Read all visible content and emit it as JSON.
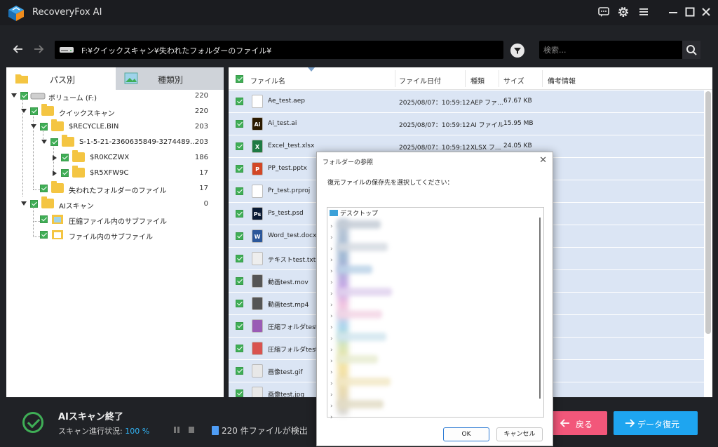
{
  "app": {
    "title": "RecoveryFox AI"
  },
  "pathbar": {
    "path": "F:¥クイックスキャン¥失われたフォルダーのファイル¥"
  },
  "search": {
    "placeholder": "検索..."
  },
  "tabs": [
    {
      "label": "パス別"
    },
    {
      "label": "種類別"
    }
  ],
  "tree": [
    {
      "label": "ボリューム (F:)",
      "count": "220"
    },
    {
      "label": "クイックスキャン",
      "count": "220"
    },
    {
      "label": "$RECYCLE.BIN",
      "count": "203"
    },
    {
      "label": "S-1-5-21-2360635849-3274489...",
      "count": "203"
    },
    {
      "label": "$R0KCZWX",
      "count": "186"
    },
    {
      "label": "$R5XFW9C",
      "count": "17"
    },
    {
      "label": "失われたフォルダーのファイル",
      "count": "17"
    },
    {
      "label": "AIスキャン",
      "count": "0"
    },
    {
      "label": "圧縮ファイル内のサブファイル",
      "count": ""
    },
    {
      "label": "ファイル内のサブファイル",
      "count": ""
    }
  ],
  "table": {
    "columns": [
      "ファイル名",
      "ファイル日付",
      "種類",
      "サイズ",
      "備考情報"
    ],
    "rows": [
      {
        "name": "Ae_test.aep",
        "date": "2025/08/07：10:59:12",
        "type": "AEP ファ...",
        "size": "67.67 KB",
        "icon": "ae-file-icon",
        "iconColor": "#ffffff",
        "iconText": ""
      },
      {
        "name": "Ai_test.ai",
        "date": "2025/08/07：10:59:12",
        "type": "AI ファイル",
        "size": "15.95 MB",
        "icon": "illustrator-icon",
        "iconColor": "#2b1a00",
        "iconText": "Ai"
      },
      {
        "name": "Excel_test.xlsx",
        "date": "2025/08/07：10:59:12",
        "type": "XLSX フ...",
        "size": "24.05 KB",
        "icon": "excel-icon",
        "iconColor": "#1f7a43",
        "iconText": "X"
      },
      {
        "name": "PP_test.pptx",
        "date": "",
        "type": "",
        "size": "",
        "icon": "powerpoint-icon",
        "iconColor": "#d24726",
        "iconText": "P"
      },
      {
        "name": "Pr_test.prproj",
        "date": "",
        "type": "",
        "size": "",
        "icon": "premiere-file-icon",
        "iconColor": "#ffffff",
        "iconText": ""
      },
      {
        "name": "Ps_test.psd",
        "date": "",
        "type": "",
        "size": "",
        "icon": "photoshop-icon",
        "iconColor": "#0a1a33",
        "iconText": "Ps"
      },
      {
        "name": "Word_test.docx",
        "date": "",
        "type": "",
        "size": "",
        "icon": "word-icon",
        "iconColor": "#2b579a",
        "iconText": "W"
      },
      {
        "name": "テキストtest.txt",
        "date": "",
        "type": "",
        "size": "",
        "icon": "text-file-icon",
        "iconColor": "#eeeeee",
        "iconText": ""
      },
      {
        "name": "動画test.mov",
        "date": "",
        "type": "",
        "size": "",
        "icon": "video-file-icon",
        "iconColor": "#555555",
        "iconText": ""
      },
      {
        "name": "動画test.mp4",
        "date": "",
        "type": "",
        "size": "",
        "icon": "video-file-icon",
        "iconColor": "#555555",
        "iconText": ""
      },
      {
        "name": "圧縮フォルダtest.r",
        "date": "",
        "type": "",
        "size": "",
        "icon": "archive-icon",
        "iconColor": "#9a5bb5",
        "iconText": ""
      },
      {
        "name": "圧縮フォルダtest.z",
        "date": "",
        "type": "",
        "size": "",
        "icon": "zip-icon",
        "iconColor": "#d9534f",
        "iconText": ""
      },
      {
        "name": "画像test.gif",
        "date": "",
        "type": "",
        "size": "",
        "icon": "gif-icon",
        "iconColor": "#e8e8e8",
        "iconText": ""
      },
      {
        "name": "画像test.jpg",
        "date": "",
        "type": "",
        "size": "",
        "icon": "image-icon",
        "iconColor": "#e8e8e8",
        "iconText": ""
      }
    ]
  },
  "status": {
    "title": "AIスキャン終了",
    "progress_label": "スキャン進行状況: ",
    "progress_value": "100 %",
    "found": "220 件ファイルが検出"
  },
  "buttons": {
    "back": "戻る",
    "recover": "データ復元"
  },
  "dialog": {
    "title": "フォルダーの参照",
    "message": "復元ファイルの保存先を選択してください：",
    "root": "デスクトップ",
    "ok": "OK",
    "cancel": "キャンセル"
  },
  "colors": {
    "accent": "#1ea5f0",
    "back": "#f2577a",
    "success": "#3fae56",
    "rowSelected": "#dbe5f4"
  }
}
